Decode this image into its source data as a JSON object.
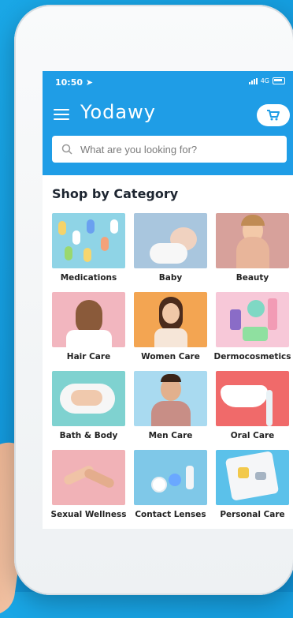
{
  "status": {
    "time": "10:50",
    "network": "4G"
  },
  "app": {
    "name": "Yodawy"
  },
  "search": {
    "placeholder": "What are you looking for?"
  },
  "section_title": "Shop by Category",
  "categories": [
    {
      "label": "Medications",
      "color": "#8fd4e6"
    },
    {
      "label": "Baby",
      "color": "#a9c6de"
    },
    {
      "label": "Beauty",
      "color": "#d7a19b"
    },
    {
      "label": "Hair Care",
      "color": "#f2b6bf"
    },
    {
      "label": "Women Care",
      "color": "#f3a552"
    },
    {
      "label": "Dermocosmetics",
      "color": "#f7c8d8"
    },
    {
      "label": "Bath & Body",
      "color": "#7fd2d0"
    },
    {
      "label": "Men Care",
      "color": "#a9daf0"
    },
    {
      "label": "Oral Care",
      "color": "#f06a6a"
    },
    {
      "label": "Sexual Wellness",
      "color": "#f1b2b7"
    },
    {
      "label": "Contact Lenses",
      "color": "#7fc8e8"
    },
    {
      "label": "Personal Care",
      "color": "#5bc1ea"
    }
  ],
  "colors": {
    "appbar": "#1f9de6",
    "background": "#1aa7e6"
  }
}
